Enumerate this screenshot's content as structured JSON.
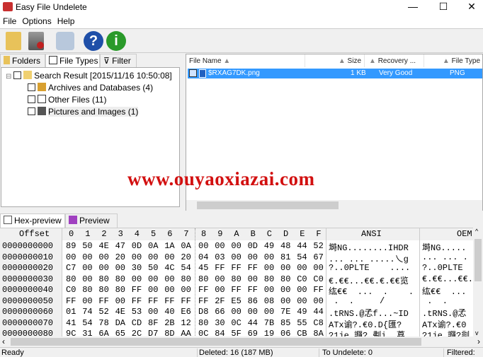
{
  "window": {
    "title": "Easy File Undelete",
    "minimize": "—",
    "maximize": "☐",
    "close": "✕"
  },
  "menu": [
    "File",
    "Options",
    "Help"
  ],
  "toolbar": [
    {
      "icon": "search-folder-icon",
      "color": "#e8c25a"
    },
    {
      "icon": "recover-icon",
      "color": "#b02020"
    },
    {
      "icon": "settings-icon",
      "color": "#8aa6c8"
    },
    {
      "icon": "help-icon",
      "label": "?",
      "color": "#1f4fa8"
    },
    {
      "icon": "info-icon",
      "label": "i",
      "color": "#2a9a2a"
    }
  ],
  "left_tabs": [
    "Folders",
    "File Types",
    "Filter"
  ],
  "tree": {
    "root": "Search Result [2015/11/16 10:50:08]",
    "children": [
      "Archives and Databases (4)",
      "Other Files (11)",
      "Pictures and Images (1)"
    ]
  },
  "list": {
    "columns": [
      "File Name",
      "Size",
      "Recovery ...",
      "File Type"
    ],
    "rows": [
      {
        "name": "$RXAG7DK.png",
        "size": "1 KB",
        "recovery": "Very Good",
        "type": "PNG"
      }
    ]
  },
  "bottom_tabs": [
    "Hex-preview",
    "Preview"
  ],
  "hex": {
    "headers": {
      "offset": "Offset",
      "cols": [
        "0",
        "1",
        "2",
        "3",
        "4",
        "5",
        "6",
        "7",
        "8",
        "9",
        "A",
        "B",
        "C",
        "D",
        "E",
        "F"
      ],
      "ansi": "ANSI",
      "oem": "OEM"
    },
    "rows": [
      {
        "offset": "0000000000",
        "bytes": "89 50 4E 47 0D 0A 1A 0A 00 00 00 0D 49 48 44 52",
        "ansi": "塒NG........IHDR",
        "oem": "塒NG....."
      },
      {
        "offset": "0000000010",
        "bytes": "00 00 00 20 00 00 00 20 04 03 00 00 00 81 54 67",
        "ansi": "... ... .....乀g",
        "oem": "... ... ."
      },
      {
        "offset": "0000000020",
        "bytes": "C7 00 00 00 30 50 4C 54 45 FF FF FF 00 00 00 00",
        "ansi": "?..0PLTE    ....",
        "oem": "?..0PLTE"
      },
      {
        "offset": "0000000030",
        "bytes": "80 00 80 80 00 00 00 80 80 00 80 00 80 80 C0 C0",
        "ansi": "€.€€...€€.€.€€览",
        "oem": "€.€€...€€.€"
      },
      {
        "offset": "0000000040",
        "bytes": "C0 80 80 80 FF 00 00 00 FF 00 FF FF 00 00 00 FF",
        "ansi": "纮€€  ...  .    .",
        "oem": "纮€€  ..."
      },
      {
        "offset": "0000000050",
        "bytes": "FF 00 FF 00 FF FF FF FF FF 2F E5 86 08 00 00 00",
        "ansi": " .  .     /",
        "oem": " .  ."
      },
      {
        "offset": "0000000060",
        "bytes": "01 74 52 4E 53 00 40 E6 D8 66 00 00 00 7E 49 44",
        "ansi": ".tRNS.@孞f...~ID",
        "oem": ".tRNS.@孞"
      },
      {
        "offset": "0000000070",
        "bytes": "41 54 78 DA CD 8F 2B 12 80 30 0C 44 7B 85 55 C8",
        "ansi": "ATx谕?.€0.D{匯?",
        "oem": "ATx谕?.€0"
      },
      {
        "offset": "0000000080",
        "bytes": "9C 31 6A 65 2C D7 8D AA 0C 84 5F 69 19 06 CB 8A",
        "ansi": "?1je,讔?.刜i..藠",
        "oem": "?1je,讔?剕"
      }
    ]
  },
  "status": {
    "ready": "Ready",
    "deleted": "Deleted: 16 (187 MB)",
    "to_undelete": "To Undelete: 0",
    "filtered": "Filtered:"
  },
  "watermark": "www.ouyaoxiazai.com",
  "colors": {
    "selection": "#3399ff",
    "watermark": "#d21010"
  }
}
